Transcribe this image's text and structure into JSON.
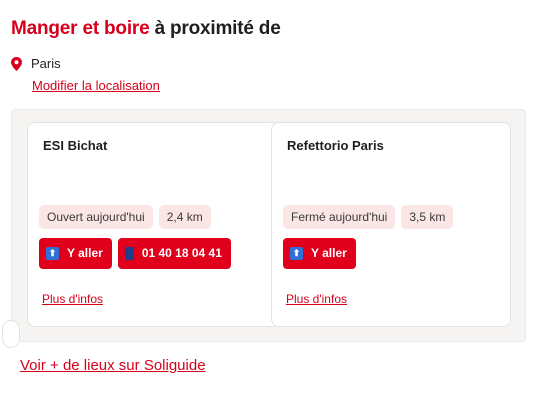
{
  "header": {
    "title_accent": "Manger et boire",
    "title_rest": " à proximité de",
    "location": "Paris",
    "modify_link": "Modifier la localisation"
  },
  "places": [
    {
      "name": "ESI Bichat",
      "status": "Ouvert aujourd'hui",
      "distance": "2,4 km",
      "go_label": "Y aller",
      "phone": "01 40 18 04 41",
      "more_link": "Plus d'infos"
    },
    {
      "name": "Refettorio Paris",
      "status": "Fermé aujourd'hui",
      "distance": "3,5 km",
      "go_label": "Y aller",
      "more_link": "Plus d'infos"
    }
  ],
  "footer": {
    "see_more": "Voir + de lieux sur Soliguide"
  },
  "colors": {
    "accent": "#d6001c",
    "button": "#e0001b",
    "badge_bg": "#fbe6e6",
    "panel_bg": "#f5f4f2"
  },
  "icons": {
    "location": "map-pin-icon",
    "go": "arrow-up-icon",
    "phone": "phone-icon"
  }
}
